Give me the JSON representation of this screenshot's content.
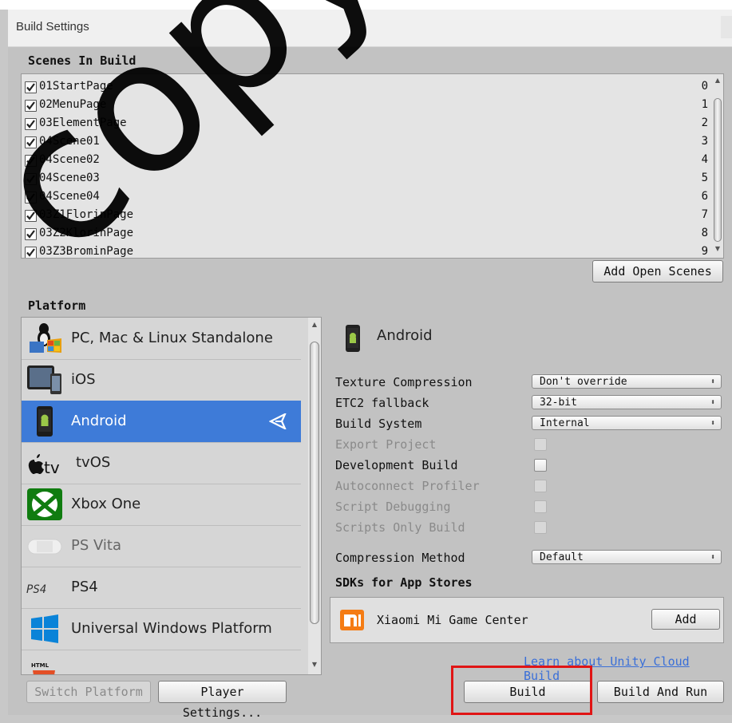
{
  "window": {
    "title": "Build Settings"
  },
  "scenes": {
    "heading": "Scenes In Build",
    "items": [
      {
        "name": "01StartPage",
        "index": "0"
      },
      {
        "name": "02MenuPage",
        "index": "1"
      },
      {
        "name": "03ElementPage",
        "index": "2"
      },
      {
        "name": "04Scene01",
        "index": "3"
      },
      {
        "name": "04Scene02",
        "index": "4"
      },
      {
        "name": "04Scene03",
        "index": "5"
      },
      {
        "name": "04Scene04",
        "index": "6"
      },
      {
        "name": "03Z1FlorinPage",
        "index": "7"
      },
      {
        "name": "03Z2KlorinPage",
        "index": "8"
      },
      {
        "name": "03Z3BrominPage",
        "index": "9"
      }
    ],
    "add_open_scenes": "Add Open Scenes"
  },
  "platform": {
    "heading": "Platform",
    "items": [
      {
        "label": "PC, Mac & Linux Standalone",
        "icon": "pc-mac-linux-icon"
      },
      {
        "label": "iOS",
        "icon": "ios-devices-icon"
      },
      {
        "label": "Android",
        "icon": "android-phone-icon"
      },
      {
        "label": "tvOS",
        "icon": "apple-tv-icon"
      },
      {
        "label": "Xbox One",
        "icon": "xbox-icon"
      },
      {
        "label": "PS Vita",
        "icon": "ps-vita-icon"
      },
      {
        "label": "PS4",
        "icon": "ps4-logo-icon"
      },
      {
        "label": "Universal Windows Platform",
        "icon": "windows-icon"
      },
      {
        "label": "",
        "icon": "html5-icon"
      }
    ],
    "selected": "Android",
    "switch_platform": "Switch Platform",
    "player_settings": "Player Settings..."
  },
  "settings": {
    "platform_name": "Android",
    "texture_compression": {
      "label": "Texture Compression",
      "value": "Don't override"
    },
    "etc2_fallback": {
      "label": "ETC2 fallback",
      "value": "32-bit"
    },
    "build_system": {
      "label": "Build System",
      "value": "Internal"
    },
    "export_project": "Export Project",
    "development_build": "Development Build",
    "autoconnect_profiler": "Autoconnect Profiler",
    "script_debugging": "Script Debugging",
    "scripts_only_build": "Scripts Only Build",
    "compression_method": {
      "label": "Compression Method",
      "value": "Default"
    },
    "sdks_heading": "SDKs for App Stores",
    "sdk": {
      "name": "Xiaomi Mi Game Center",
      "add": "Add",
      "icon": "xiaomi-mi-icon"
    },
    "learn_link": "Learn about Unity Cloud Build"
  },
  "buttons": {
    "build": "Build",
    "build_and_run": "Build And Run"
  },
  "watermark": "copyright@",
  "colors": {
    "selection": "#3e7bd8",
    "link": "#3a6fd8",
    "highlight_box": "#e01515"
  }
}
